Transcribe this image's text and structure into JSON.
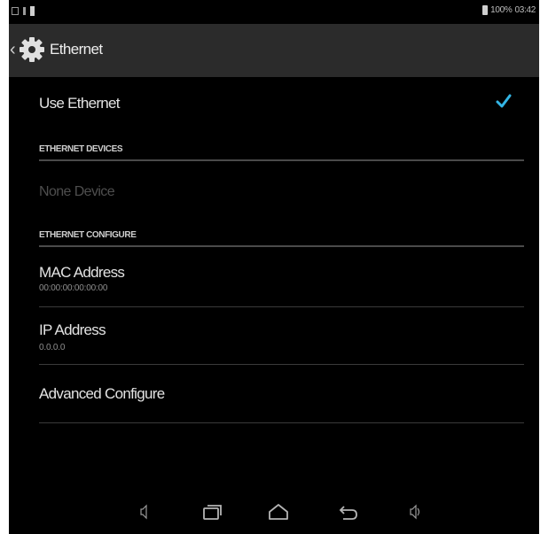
{
  "status_bar": {
    "battery_text": "100%",
    "time": "03:42"
  },
  "action_bar": {
    "title": "Ethernet",
    "icon": "settings-gear-icon"
  },
  "use_ethernet": {
    "label": "Use Ethernet",
    "checked": true
  },
  "sections": {
    "devices_header": "ETHERNET DEVICES",
    "configure_header": "ETHERNET CONFIGURE"
  },
  "devices": {
    "none_label": "None Device"
  },
  "mac": {
    "title": "MAC Address",
    "value": "00:00:00:00:00:00"
  },
  "ip": {
    "title": "IP Address",
    "value": "0.0.0.0"
  },
  "advanced": {
    "title": "Advanced Configure"
  },
  "nav_bar": {
    "buttons": [
      "volume-down-icon",
      "recent-apps-icon",
      "home-icon",
      "back-icon",
      "volume-up-icon"
    ]
  },
  "colors": {
    "background": "#000000",
    "action_bar": "#2b2b2b",
    "accent_check": "#33b5e5"
  }
}
